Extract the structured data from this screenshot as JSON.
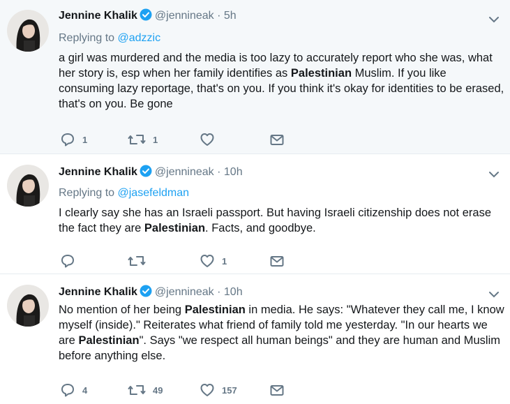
{
  "tweets": [
    {
      "name": "Jennine Khalik",
      "handle": "@jennineak",
      "dot": "·",
      "time": "5h",
      "replying_prefix": "Replying to ",
      "replying_to": "@adzzic",
      "text_parts": [
        "a girl was murdered and the media is too lazy to accurately report who she was, what her story is, esp when her family identifies as ",
        "Palestinian",
        " Muslim. If you like consuming lazy reportage, that's on you. If you think it's okay for identities to be erased, that's on you. Be gone"
      ],
      "replies": "1",
      "retweets": "1",
      "likes": ""
    },
    {
      "name": "Jennine Khalik",
      "handle": "@jennineak",
      "dot": "·",
      "time": "10h",
      "replying_prefix": "Replying to ",
      "replying_to": "@jasefeldman",
      "text_parts": [
        "I clearly say she has an Israeli passport. But having Israeli citizenship does not erase the fact they are ",
        "Palestinian",
        ". Facts, and goodbye."
      ],
      "replies": "",
      "retweets": "",
      "likes": "1"
    },
    {
      "name": "Jennine Khalik",
      "handle": "@jennineak",
      "dot": "·",
      "time": "10h",
      "text_parts": [
        "No mention of her being ",
        "Palestinian",
        " in media. He says: \"Whatever they call me, I know myself (inside).\" Reiterates what friend of family told me yesterday. \"In our hearts we are ",
        "Palestinian",
        "\". Says \"we respect all human beings\" and they are human and Muslim before anything else."
      ],
      "replies": "4",
      "retweets": "49",
      "likes": "157"
    }
  ],
  "icons": {
    "verified": "verified-badge-icon",
    "caret": "chevron-down-icon",
    "reply": "reply-icon",
    "retweet": "retweet-icon",
    "like": "heart-icon",
    "dm": "envelope-icon"
  },
  "colors": {
    "link": "#1da1f2",
    "secondary": "#657786",
    "text": "#14171a",
    "highlight_bg": "#f5f8fa"
  }
}
